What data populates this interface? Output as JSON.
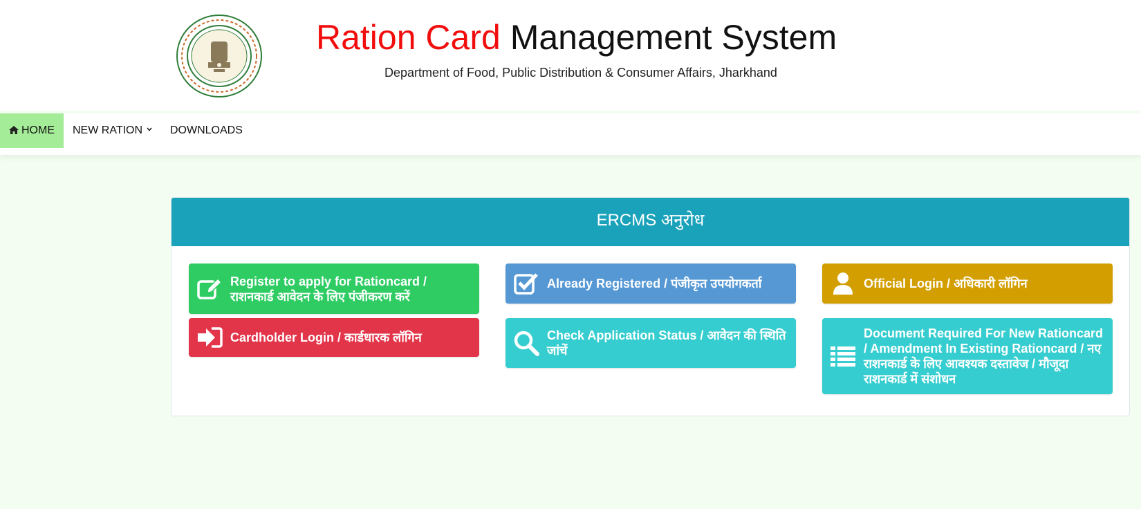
{
  "header": {
    "title_part1": "Ration Card",
    "title_part2": " Management System",
    "subtitle": "Department of Food, Public Distribution & Consumer Affairs, Jharkhand"
  },
  "nav": {
    "home": "HOME",
    "new_ration": "NEW RATION",
    "downloads": "DOWNLOADS"
  },
  "panel": {
    "title": "ERCMS अनुरोध",
    "tiles": [
      {
        "label": "Register to apply for Rationcard / राशनकार्ड आवेदन के लिए पंजीकरण करें",
        "icon": "edit-icon"
      },
      {
        "label": "Cardholder Login / कार्डधारक लॉगिन",
        "icon": "sign-in-icon"
      },
      {
        "label": "Already Registered / पंजीकृत उपयोगकर्ता",
        "icon": "check-square-icon"
      },
      {
        "label": "Check Application Status / आवेदन की स्थिति जांचें",
        "icon": "search-icon"
      },
      {
        "label": "Official Login / अधिकारी लॉगिन",
        "icon": "user-icon"
      },
      {
        "label": "Document Required For New Rationcard / Amendment In Existing Rationcard / नए राशनकार्ड के लिए आवश्यक दस्तावेज / मौजूदा राशनकार्ड में संशोधन",
        "icon": "list-icon"
      }
    ]
  },
  "colors": {
    "title_red": "#f20d0d",
    "home_active": "#a4ec97",
    "panel_header": "#1ba2bb",
    "green": "#2ecc63",
    "red": "#e3354a",
    "blue": "#5598d4",
    "cyan": "#36cdd0",
    "gold": "#d39e00",
    "page_bg": "#f3fdf1"
  }
}
